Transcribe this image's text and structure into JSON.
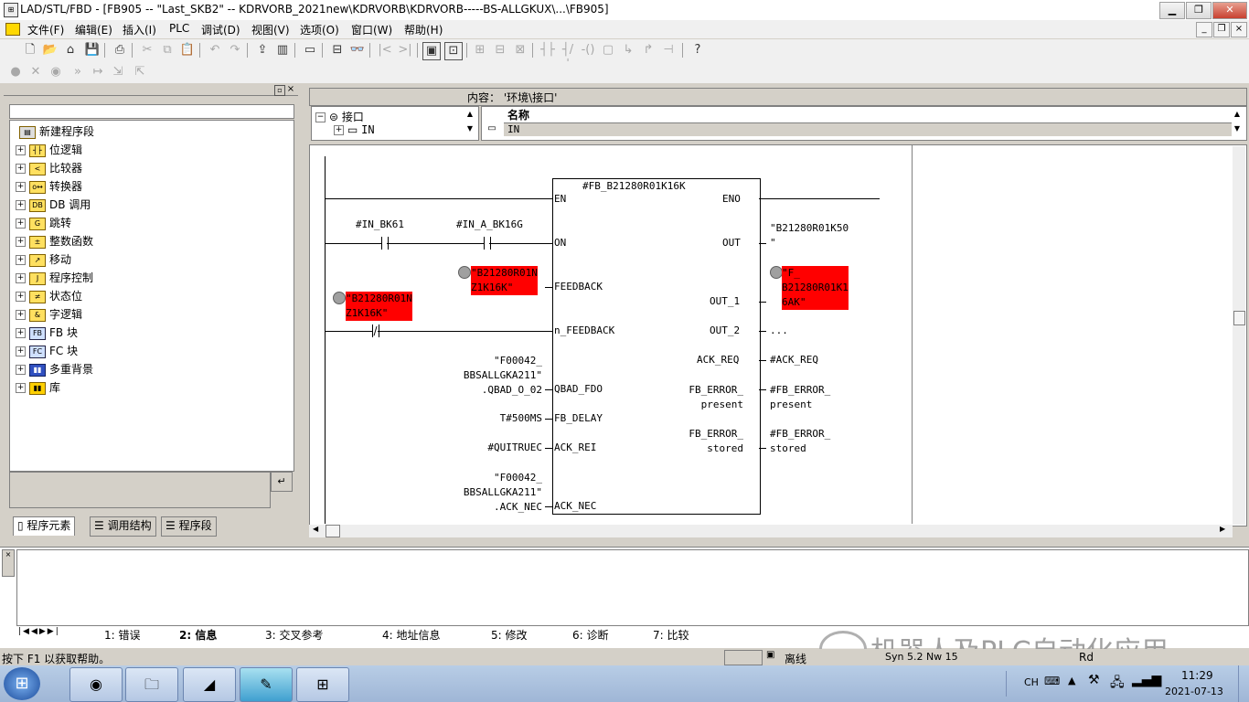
{
  "window": {
    "title": "LAD/STL/FBD  - [FB905 -- \"Last_SKB2\" -- KDRVORB_2021new\\KDRVORB\\KDRVORB-----BS-ALLGKUX\\...\\FB905]"
  },
  "menu": [
    "文件(F)",
    "编辑(E)",
    "插入(I)",
    "PLC",
    "调试(D)",
    "视图(V)",
    "选项(O)",
    "窗口(W)",
    "帮助(H)"
  ],
  "tree": {
    "items": [
      {
        "label": "新建程序段",
        "icon": "new-network-icon"
      },
      {
        "label": "位逻辑",
        "icon": "bit-logic-icon"
      },
      {
        "label": "比较器",
        "icon": "comparator-icon"
      },
      {
        "label": "转换器",
        "icon": "converter-icon"
      },
      {
        "label": "DB 调用",
        "icon": "db-call-icon"
      },
      {
        "label": "跳转",
        "icon": "jump-icon"
      },
      {
        "label": "整数函数",
        "icon": "integer-function-icon"
      },
      {
        "label": "移动",
        "icon": "move-icon"
      },
      {
        "label": "程序控制",
        "icon": "program-control-icon"
      },
      {
        "label": "状态位",
        "icon": "status-bit-icon"
      },
      {
        "label": "字逻辑",
        "icon": "word-logic-icon"
      },
      {
        "label": "FB 块",
        "icon": "fb-block-icon"
      },
      {
        "label": "FC 块",
        "icon": "fc-block-icon"
      },
      {
        "label": "多重背景",
        "icon": "multi-instance-icon"
      },
      {
        "label": "库",
        "icon": "library-icon"
      }
    ]
  },
  "left_tabs": [
    "程序元素",
    "调用结构",
    "程序段"
  ],
  "interface": {
    "content_label": "内容： '环境\\接口'",
    "tree_root": "接口",
    "tree_child": "IN",
    "column_header": "名称",
    "row_value": "IN"
  },
  "fb": {
    "instance": "#FB_B21280R01K16K",
    "inputs": [
      "EN",
      "ON",
      "FEEDBACK",
      "n_FEEDBACK",
      "QBAD_FDO",
      "FB_DELAY",
      "ACK_REI",
      "ACK_NEC"
    ],
    "outputs": [
      "ENO",
      "OUT",
      "OUT_1",
      "OUT_2",
      "ACK_REQ",
      "FB_ERROR_\npresent",
      "FB_ERROR_\nstored"
    ],
    "contacts": {
      "c1": "#IN_BK61",
      "c2": "#IN_A_BK16G"
    },
    "feedback_op": "\"B21280R01N\nZ1K16K\"",
    "nfeedback_op": "\"B21280R01N\nZ1K16K\"",
    "qbad_op": "\"F00042_\nBBSALLGKA211\"\n.QBAD_O_02",
    "delay_op": "T#500MS",
    "ackrei_op": "#QUITRUEC",
    "acknec_op": "\"F00042_\nBBSALLGKA211\"\n.ACK_NEC",
    "out_op": "\"B21280R01K50\n\"",
    "out1_op": "\"F_\nB21280R01K1\n6AK\"",
    "out2_op": "...",
    "ackreq_op": "#ACK_REQ",
    "errp_op": "#FB_ERROR_\npresent",
    "errs_op": "#FB_ERROR_\nstored"
  },
  "bottom_tabs": [
    "1: 错误",
    "2: 信息",
    "3: 交叉参考",
    "4: 地址信息",
    "5: 修改",
    "6: 诊断",
    "7: 比较"
  ],
  "status": {
    "help": "按下 F1 以获取帮助。",
    "mode": "离线",
    "extra": "Syn 5.2 Nw 15",
    "rd": "Rd"
  },
  "watermark": "机器人及PLC自动化应用",
  "taskbar": {
    "lang": "CH",
    "time": "11:29",
    "date": "2021-07-13"
  },
  "colors": {
    "highlight_red": "#ff0000"
  }
}
